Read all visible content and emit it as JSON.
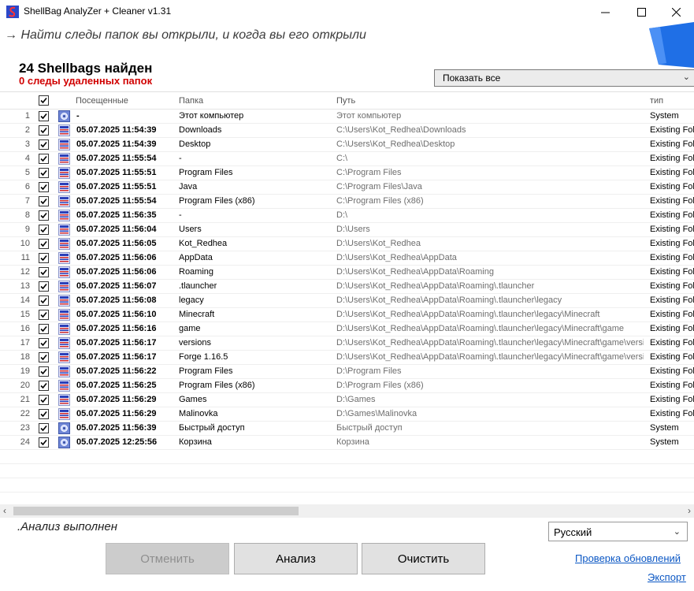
{
  "window": {
    "title": "ShellBag  AnalyZer + Cleaner v1.31",
    "minimize": "—",
    "maximize": "☐",
    "close": "✕"
  },
  "header": {
    "subtitle": "→ Найти следы папок вы открыли, и когда вы его открыли",
    "count_title": "24 Shellbags найден",
    "deleted_title": "0  следы удаленных папок",
    "filter_value": "Показать все",
    "accent_color": "#1f6fe6"
  },
  "table": {
    "columns": [
      "Посещенные",
      "Папка",
      "Путь",
      "тип"
    ],
    "rows": [
      {
        "num": "1",
        "date": "-",
        "folder": "Этот компьютер",
        "path": "Этот компьютер",
        "type": "System",
        "icon": "system-icon"
      },
      {
        "num": "2",
        "date": "05.07.2025 11:54:39",
        "folder": "Downloads",
        "path": "C:\\Users\\Kot_Redhea\\Downloads",
        "type": "Existing Folder",
        "icon": "folder-icon"
      },
      {
        "num": "3",
        "date": "05.07.2025 11:54:39",
        "folder": "Desktop",
        "path": "C:\\Users\\Kot_Redhea\\Desktop",
        "type": "Existing Folder",
        "icon": "folder-icon"
      },
      {
        "num": "4",
        "date": "05.07.2025 11:55:54",
        "folder": "-",
        "path": "C:\\",
        "type": "Existing Folder",
        "icon": "folder-icon"
      },
      {
        "num": "5",
        "date": "05.07.2025 11:55:51",
        "folder": "Program Files",
        "path": "C:\\Program Files",
        "type": "Existing Folder",
        "icon": "folder-icon"
      },
      {
        "num": "6",
        "date": "05.07.2025 11:55:51",
        "folder": "Java",
        "path": "C:\\Program Files\\Java",
        "type": "Existing Folder",
        "icon": "folder-icon"
      },
      {
        "num": "7",
        "date": "05.07.2025 11:55:54",
        "folder": "Program Files (x86)",
        "path": "C:\\Program Files (x86)",
        "type": "Existing Folder",
        "icon": "folder-icon"
      },
      {
        "num": "8",
        "date": "05.07.2025 11:56:35",
        "folder": "-",
        "path": "D:\\",
        "type": "Existing Folder",
        "icon": "folder-icon"
      },
      {
        "num": "9",
        "date": "05.07.2025 11:56:04",
        "folder": "Users",
        "path": "D:\\Users",
        "type": "Existing Folder",
        "icon": "folder-icon"
      },
      {
        "num": "10",
        "date": "05.07.2025 11:56:05",
        "folder": "Kot_Redhea",
        "path": "D:\\Users\\Kot_Redhea",
        "type": "Existing Folder",
        "icon": "folder-icon"
      },
      {
        "num": "11",
        "date": "05.07.2025 11:56:06",
        "folder": "AppData",
        "path": "D:\\Users\\Kot_Redhea\\AppData",
        "type": "Existing Folder",
        "icon": "folder-icon"
      },
      {
        "num": "12",
        "date": "05.07.2025 11:56:06",
        "folder": "Roaming",
        "path": "D:\\Users\\Kot_Redhea\\AppData\\Roaming",
        "type": "Existing Folder",
        "icon": "folder-icon"
      },
      {
        "num": "13",
        "date": "05.07.2025 11:56:07",
        "folder": ".tlauncher",
        "path": "D:\\Users\\Kot_Redhea\\AppData\\Roaming\\.tlauncher",
        "type": "Existing Folder",
        "icon": "folder-icon"
      },
      {
        "num": "14",
        "date": "05.07.2025 11:56:08",
        "folder": "legacy",
        "path": "D:\\Users\\Kot_Redhea\\AppData\\Roaming\\.tlauncher\\legacy",
        "type": "Existing Folder",
        "icon": "folder-icon"
      },
      {
        "num": "15",
        "date": "05.07.2025 11:56:10",
        "folder": "Minecraft",
        "path": "D:\\Users\\Kot_Redhea\\AppData\\Roaming\\.tlauncher\\legacy\\Minecraft",
        "type": "Existing Folder",
        "icon": "folder-icon"
      },
      {
        "num": "16",
        "date": "05.07.2025 11:56:16",
        "folder": "game",
        "path": "D:\\Users\\Kot_Redhea\\AppData\\Roaming\\.tlauncher\\legacy\\Minecraft\\game",
        "type": "Existing Folder",
        "icon": "folder-icon"
      },
      {
        "num": "17",
        "date": "05.07.2025 11:56:17",
        "folder": "versions",
        "path": "D:\\Users\\Kot_Redhea\\AppData\\Roaming\\.tlauncher\\legacy\\Minecraft\\game\\versi...",
        "type": "Existing Folder",
        "icon": "folder-icon"
      },
      {
        "num": "18",
        "date": "05.07.2025 11:56:17",
        "folder": "Forge 1.16.5",
        "path": "D:\\Users\\Kot_Redhea\\AppData\\Roaming\\.tlauncher\\legacy\\Minecraft\\game\\versi...",
        "type": "Existing Folder",
        "icon": "folder-icon"
      },
      {
        "num": "19",
        "date": "05.07.2025 11:56:22",
        "folder": "Program Files",
        "path": "D:\\Program Files",
        "type": "Existing Folder",
        "icon": "folder-icon"
      },
      {
        "num": "20",
        "date": "05.07.2025 11:56:25",
        "folder": "Program Files (x86)",
        "path": "D:\\Program Files (x86)",
        "type": "Existing Folder",
        "icon": "folder-icon"
      },
      {
        "num": "21",
        "date": "05.07.2025 11:56:29",
        "folder": "Games",
        "path": "D:\\Games",
        "type": "Existing Folder",
        "icon": "folder-icon"
      },
      {
        "num": "22",
        "date": "05.07.2025 11:56:29",
        "folder": "Malinovka",
        "path": "D:\\Games\\Malinovka",
        "type": "Existing Folder",
        "icon": "folder-icon"
      },
      {
        "num": "23",
        "date": "05.07.2025 11:56:39",
        "folder": "Быстрый доступ",
        "path": "Быстрый доступ",
        "type": "System",
        "icon": "system-icon"
      },
      {
        "num": "24",
        "date": "05.07.2025 12:25:56",
        "folder": "Корзина",
        "path": "Корзина",
        "type": "System",
        "icon": "system-icon"
      }
    ]
  },
  "status": {
    "text": ".Анализ выполнен"
  },
  "language": {
    "value": "Русский"
  },
  "buttons": {
    "cancel": "Отменить",
    "analyze": "Анализ",
    "clean": "Очистить"
  },
  "links": {
    "update": "Проверка обновлений",
    "export": "Экспорт"
  }
}
